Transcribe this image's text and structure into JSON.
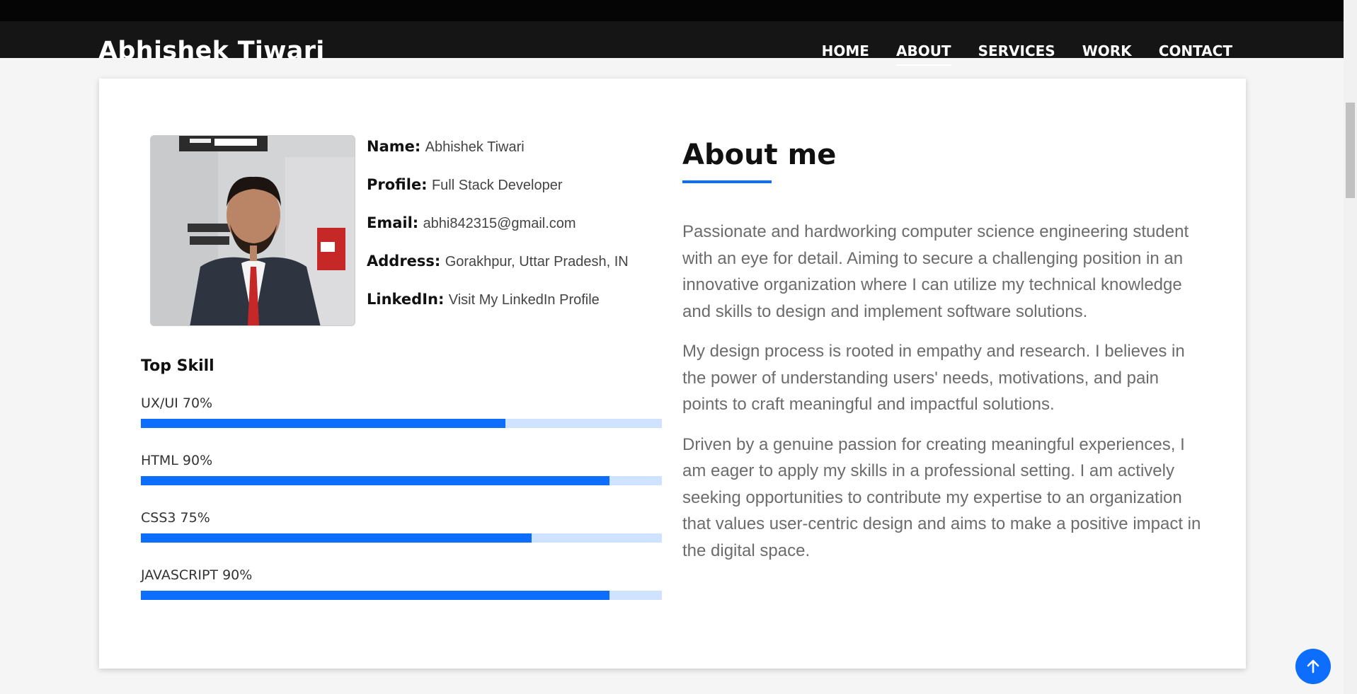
{
  "header": {
    "brand": "Abhishek Tiwari",
    "nav": [
      {
        "label": "HOME",
        "active": false
      },
      {
        "label": "ABOUT",
        "active": true
      },
      {
        "label": "SERVICES",
        "active": false
      },
      {
        "label": "WORK",
        "active": false
      },
      {
        "label": "CONTACT",
        "active": false
      }
    ]
  },
  "profile": {
    "photo_alt": "profile-photo",
    "fields": [
      {
        "key": "Name:",
        "value": "Abhishek Tiwari"
      },
      {
        "key": "Profile:",
        "value": "Full Stack Developer"
      },
      {
        "key": "Email:",
        "value": "abhi842315@gmail.com"
      },
      {
        "key": "Address:",
        "value": "Gorakhpur, Uttar Pradesh, IN"
      },
      {
        "key": "LinkedIn:",
        "value": "Visit My LinkedIn Profile"
      }
    ]
  },
  "skills": {
    "title": "Top Skill",
    "items": [
      {
        "label": "UX/UI 70%",
        "percent": 70
      },
      {
        "label": "HTML 90%",
        "percent": 90
      },
      {
        "label": "CSS3 75%",
        "percent": 75
      },
      {
        "label": "JAVASCRIPT 90%",
        "percent": 90
      }
    ]
  },
  "about": {
    "title": "About me",
    "paragraphs": [
      "Passionate and hardworking computer science engineering student with an eye for detail. Aiming to secure a challenging position in an innovative organization where I can utilize my technical knowledge and skills to design and implement software solutions.",
      "My design process is rooted in empathy and research. I believes in the power of understanding users' needs, motivations, and pain points to craft meaningful and impactful solutions.",
      "Driven by a genuine passion for creating meaningful experiences, I am eager to apply my skills in a professional setting. I am actively seeking opportunities to contribute my expertise to an organization that values user-centric design and aims to make a positive impact in the digital space."
    ]
  },
  "colors": {
    "accent": "#0d6efd",
    "accent_light": "#cfe2ff",
    "nav_bg": "#151515"
  },
  "back_to_top": {
    "icon": "arrow-up-icon"
  }
}
